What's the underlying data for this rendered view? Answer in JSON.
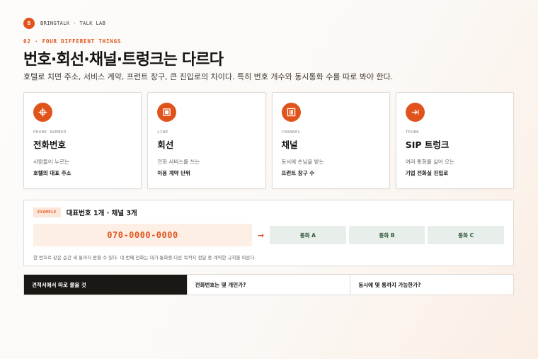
{
  "brand": {
    "logo": "B",
    "name": "BRINGTALK · TALK LAB"
  },
  "eyebrow": "02 · FOUR DIFFERENT THINGS",
  "title": "번호·회선·채널·트렁크는 다르다",
  "subtitle": "호텔로 치면 주소, 서비스 계약, 프런트 창구, 큰 진입로의 차이다. 특히 번호 개수와 동시통화 수를 따로 봐야 한다.",
  "cards": [
    {
      "icon": "crosshair-icon",
      "tag": "PHONE NUMBER",
      "title": "전화번호",
      "desc": "사람들이 누르는",
      "strong": "호텔의 대표 주소"
    },
    {
      "icon": "square-icon",
      "tag": "LINE",
      "title": "회선",
      "desc": "전화 서비스를 쓰는",
      "strong": "이용 계약 단위"
    },
    {
      "icon": "bars-icon",
      "tag": "CHANNEL",
      "title": "채널",
      "desc": "동시에 손님을 받는",
      "strong": "프런트 창구 수"
    },
    {
      "icon": "arrow-bar-icon",
      "tag": "TRUNK",
      "title": "SIP 트렁크",
      "desc": "여러 통화를 실어 오는",
      "strong": "기업 전화실 진입로"
    }
  ],
  "example": {
    "badge": "EXAMPLE",
    "title": "대표번호 1개 · 채널 3개",
    "number": "070-0000-0000",
    "arrow": "→",
    "channels": [
      "통화 A",
      "통화 B",
      "통화 C"
    ],
    "note": "한 번호로 같은 순간 세 통까지 받을 수 있다. 네 번째 전화는 대기·통화중·다른 목적지 전달 중 계약한 규칙을 따른다."
  },
  "tabs": [
    {
      "label": "견적서에서 따로 물을 것",
      "active": true
    },
    {
      "label": "전화번호는 몇 개인가?",
      "active": false
    },
    {
      "label": "동시에 몇 통까지 가능한가?",
      "active": false
    }
  ],
  "colors": {
    "accent": "#e0541c",
    "channel_bg": "#e8eee9",
    "active_tab": "#1b1714"
  }
}
